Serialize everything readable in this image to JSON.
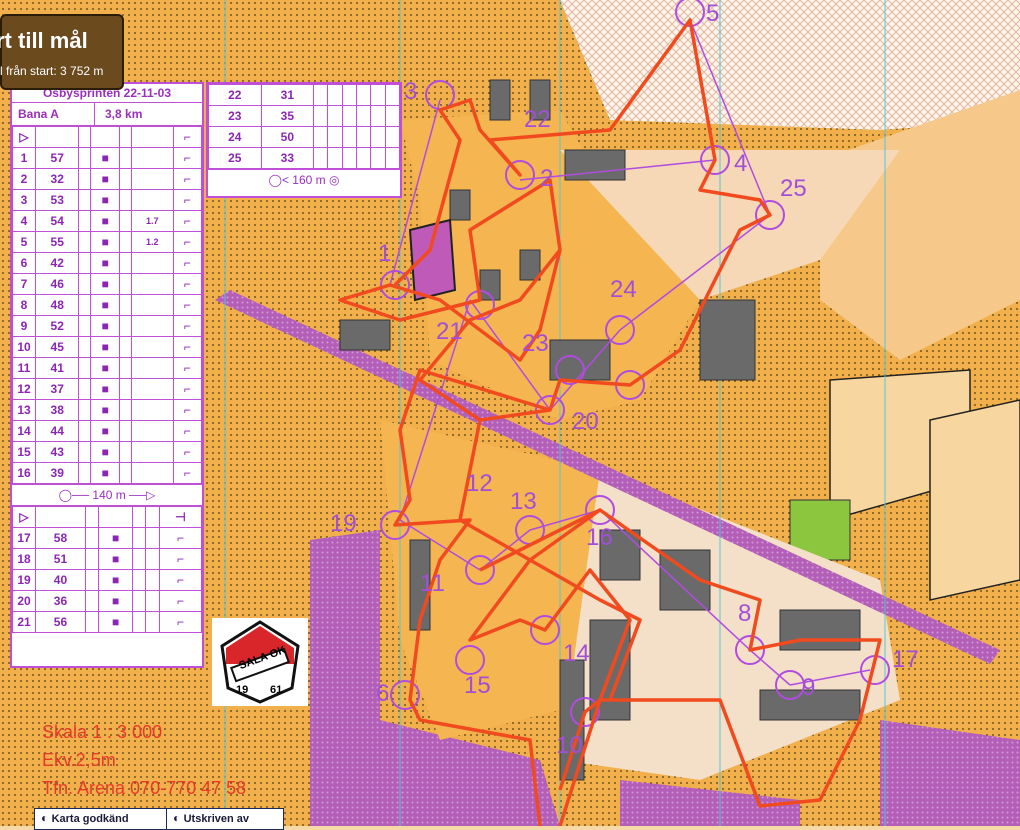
{
  "header": {
    "title": "rt till mål",
    "subtitle": "l från start: 3 752 m"
  },
  "event": {
    "name": "Ösbysprinten 22-11-03",
    "course_label": "Bana A",
    "course_length": "3,8 km"
  },
  "controls_left": [
    {
      "n": "1",
      "code": "57"
    },
    {
      "n": "2",
      "code": "32"
    },
    {
      "n": "3",
      "code": "53"
    },
    {
      "n": "4",
      "code": "54",
      "dim": "1.7"
    },
    {
      "n": "5",
      "code": "55",
      "dim": "1.2"
    },
    {
      "n": "6",
      "code": "42"
    },
    {
      "n": "7",
      "code": "46"
    },
    {
      "n": "8",
      "code": "48"
    },
    {
      "n": "9",
      "code": "52"
    },
    {
      "n": "10",
      "code": "45"
    },
    {
      "n": "11",
      "code": "41"
    },
    {
      "n": "12",
      "code": "37"
    },
    {
      "n": "13",
      "code": "38"
    },
    {
      "n": "14",
      "code": "44"
    },
    {
      "n": "15",
      "code": "43"
    },
    {
      "n": "16",
      "code": "39"
    }
  ],
  "marked_route_1": "140 m",
  "controls_left_2": [
    {
      "n": "17",
      "code": "58"
    },
    {
      "n": "18",
      "code": "51"
    },
    {
      "n": "19",
      "code": "40"
    },
    {
      "n": "20",
      "code": "36"
    },
    {
      "n": "21",
      "code": "56"
    }
  ],
  "controls_right": [
    {
      "n": "22",
      "code": "31"
    },
    {
      "n": "23",
      "code": "35"
    },
    {
      "n": "24",
      "code": "50"
    },
    {
      "n": "25",
      "code": "33"
    }
  ],
  "marked_route_2": "160 m",
  "map_labels": [
    "1",
    "2",
    "3",
    "4",
    "5",
    "6",
    "8",
    "9",
    "10",
    "11",
    "12",
    "13",
    "14",
    "15",
    "16",
    "17",
    "19",
    "20",
    "21",
    "22",
    "23",
    "24",
    "25"
  ],
  "footer": {
    "scale": "Skala 1 : 3 000",
    "equidistance": "Ekv.2,5m",
    "phone": "Tfn. Arena 070-770 47 58"
  },
  "logo": {
    "club": "SALA OK",
    "year_left": "19",
    "year_right": "61"
  },
  "badges": {
    "approved": "Karta godkänd",
    "printed": "Utskriven av"
  },
  "colors": {
    "route": "#f04a1e",
    "course": "#b04ce0",
    "open": "#f4b04a",
    "building": "#6a6a6a"
  }
}
